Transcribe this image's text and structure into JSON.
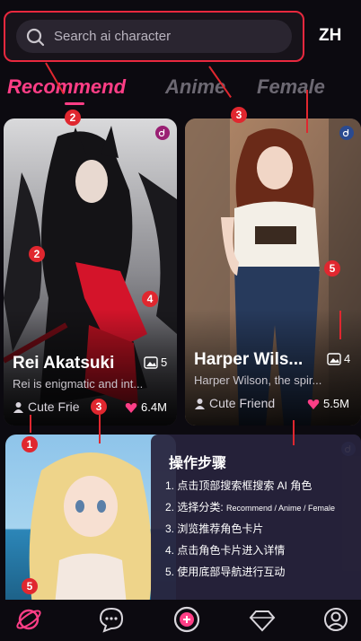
{
  "search": {
    "placeholder": "Search ai character"
  },
  "language_toggle": "ZH",
  "tabs": [
    {
      "label": "Recommend",
      "active": true
    },
    {
      "label": "Anime",
      "active": false
    },
    {
      "label": "Female",
      "active": false
    }
  ],
  "cards": [
    {
      "name": "Rei Akatsuki",
      "description": "Rei is enigmatic and int...",
      "tag": "Cute Frie",
      "likes": "6.4M",
      "image_count": "5",
      "badge_icon": "tiktok-pink-icon"
    },
    {
      "name": "Harper Wils...",
      "description": "Harper Wilson, the spir...",
      "tag": "Cute Friend",
      "likes": "5.5M",
      "image_count": "4",
      "badge_icon": "tiktok-blue-icon"
    },
    {
      "badge_icon": "tiktok-blue-icon"
    }
  ],
  "steps": {
    "title": "操作步骤",
    "items": [
      {
        "prefix": "1. 点击顶部搜索框搜索 AI 角色",
        "suffix": ""
      },
      {
        "prefix": "2. 选择分类: ",
        "suffix": "Recommend / Anime / Female"
      },
      {
        "prefix": "3. 浏览推荐角色卡片",
        "suffix": ""
      },
      {
        "prefix": "4. 点击角色卡片进入详情",
        "suffix": ""
      },
      {
        "prefix": "5. 使用底部导航进行互动",
        "suffix": ""
      }
    ]
  },
  "markers": [
    "2",
    "3",
    "2",
    "4",
    "5",
    "3",
    "1",
    "5"
  ],
  "colors": {
    "accent": "#ff3e86",
    "marker": "#e0272f",
    "panel": "#28243c",
    "background": "#0c0a10"
  },
  "bottom_nav": [
    {
      "icon": "planet-icon",
      "active": true
    },
    {
      "icon": "chat-bubble-icon",
      "active": false
    },
    {
      "icon": "add-circle-icon",
      "active": false
    },
    {
      "icon": "diamond-icon",
      "active": false
    },
    {
      "icon": "profile-icon",
      "active": false
    }
  ]
}
